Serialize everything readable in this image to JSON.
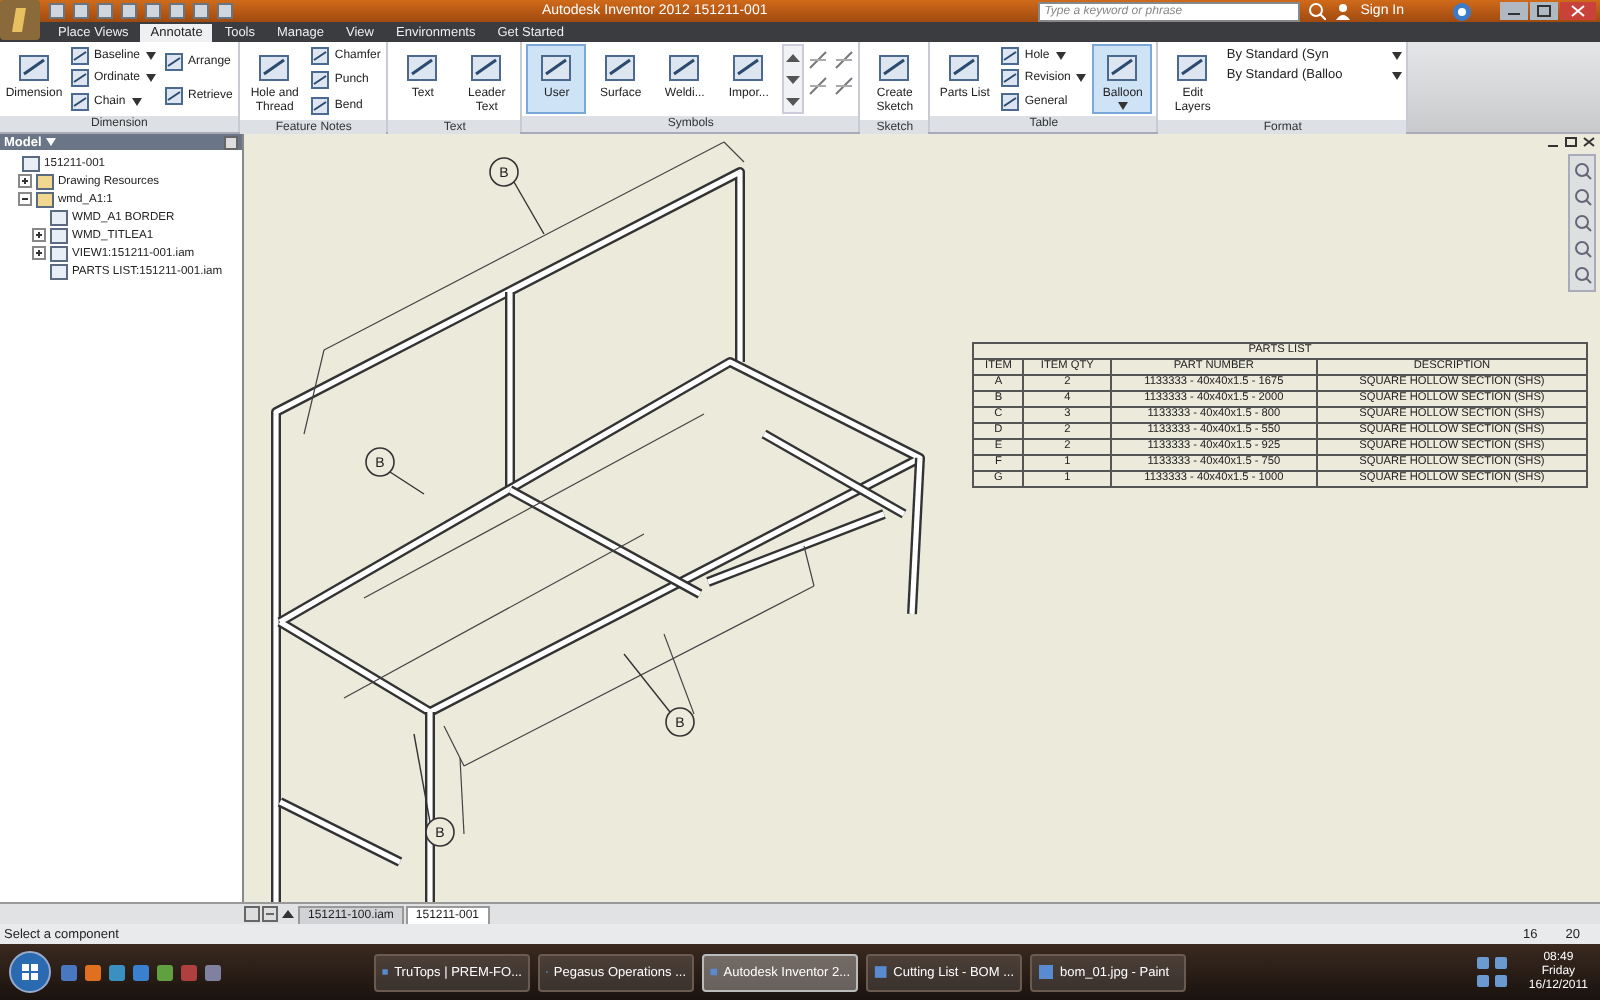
{
  "window": {
    "title": "Autodesk Inventor 2012   151211-001",
    "search": {
      "placeholder": "Type a keyword or phrase"
    },
    "sign_in": "Sign In"
  },
  "ribbon_tabs": [
    {
      "label": "Place Views",
      "selected": false
    },
    {
      "label": "Annotate",
      "selected": true
    },
    {
      "label": "Tools",
      "selected": false
    },
    {
      "label": "Manage",
      "selected": false
    },
    {
      "label": "View",
      "selected": false
    },
    {
      "label": "Environments",
      "selected": false
    },
    {
      "label": "Get Started",
      "selected": false
    }
  ],
  "ribbon": {
    "groups": [
      {
        "label": "Dimension",
        "items": [
          {
            "kind": "large",
            "label": "Dimension",
            "selected": false
          },
          {
            "kind": "small",
            "label": "Baseline",
            "dropdown": true,
            "selected": false
          },
          {
            "kind": "small",
            "label": "Ordinate",
            "dropdown": true,
            "selected": false
          },
          {
            "kind": "small",
            "label": "Chain",
            "dropdown": true,
            "selected": false
          },
          {
            "kind": "small",
            "label": "Arrange",
            "selected": false
          },
          {
            "kind": "small",
            "label": "Retrieve",
            "selected": false
          }
        ]
      },
      {
        "label": "Feature Notes",
        "items": [
          {
            "kind": "large",
            "label": "Hole and Thread",
            "selected": false
          },
          {
            "kind": "small",
            "label": "Chamfer",
            "selected": false
          },
          {
            "kind": "small",
            "label": "Punch",
            "selected": false
          },
          {
            "kind": "small",
            "label": "Bend",
            "selected": false
          }
        ]
      },
      {
        "label": "Text",
        "items": [
          {
            "kind": "large",
            "label": "Text",
            "selected": false
          },
          {
            "kind": "large",
            "label": "Leader Text",
            "selected": false
          }
        ]
      },
      {
        "label": "Symbols",
        "items": [
          {
            "kind": "large",
            "label": "User",
            "selected": true
          },
          {
            "kind": "large",
            "label": "Surface",
            "selected": false
          },
          {
            "kind": "large",
            "label": "Weldi...",
            "selected": false
          },
          {
            "kind": "large",
            "label": "Impor...",
            "selected": false
          },
          {
            "kind": "icons",
            "selected": false
          }
        ]
      },
      {
        "label": "Sketch",
        "items": [
          {
            "kind": "large",
            "label": "Create Sketch",
            "selected": false
          }
        ]
      },
      {
        "label": "Table",
        "items": [
          {
            "kind": "large",
            "label": "Parts List",
            "selected": false
          },
          {
            "kind": "small",
            "label": "Hole",
            "dropdown": true,
            "selected": false
          },
          {
            "kind": "small",
            "label": "Revision",
            "dropdown": true,
            "selected": false
          },
          {
            "kind": "small",
            "label": "General",
            "selected": false
          },
          {
            "kind": "large",
            "label": "Balloon",
            "dropdown": true,
            "selected": true
          }
        ]
      },
      {
        "label": "Format",
        "items": [
          {
            "kind": "large",
            "label": "Edit Layers",
            "selected": false
          },
          {
            "kind": "combo",
            "label": "By Standard (Syn",
            "selected": false
          },
          {
            "kind": "combo",
            "label": "By Standard (Balloo",
            "selected": false
          }
        ]
      }
    ]
  },
  "browser": {
    "title": "Model",
    "tree": [
      {
        "label": "151211-001",
        "children": [
          {
            "label": "Drawing Resources",
            "expanded": false
          },
          {
            "label": "wmd_A1:1",
            "expanded": true,
            "children": [
              {
                "label": "WMD_A1 BORDER"
              },
              {
                "label": "WMD_TITLEA1",
                "expanded": false
              },
              {
                "label": "VIEW1:151211-001.iam",
                "expanded": false
              },
              {
                "label": "PARTS LIST:151211-001.iam"
              }
            ]
          }
        ]
      }
    ]
  },
  "drawing": {
    "balloons": [
      "B",
      "B",
      "B",
      "B"
    ],
    "parts_list": {
      "title": "PARTS LIST",
      "columns": [
        "ITEM",
        "ITEM QTY",
        "PART NUMBER",
        "DESCRIPTION"
      ],
      "rows": [
        [
          "A",
          "2",
          "1133333 - 40x40x1.5 - 1675",
          "SQUARE HOLLOW SECTION (SHS)"
        ],
        [
          "B",
          "4",
          "1133333 - 40x40x1.5 - 2000",
          "SQUARE HOLLOW SECTION (SHS)"
        ],
        [
          "C",
          "3",
          "1133333 - 40x40x1.5 - 800",
          "SQUARE HOLLOW SECTION (SHS)"
        ],
        [
          "D",
          "2",
          "1133333 - 40x40x1.5 - 550",
          "SQUARE HOLLOW SECTION (SHS)"
        ],
        [
          "E",
          "2",
          "1133333 - 40x40x1.5 - 925",
          "SQUARE HOLLOW SECTION (SHS)"
        ],
        [
          "F",
          "1",
          "1133333 - 40x40x1.5 - 750",
          "SQUARE HOLLOW SECTION (SHS)"
        ],
        [
          "G",
          "1",
          "1133333 - 40x40x1.5 - 1000",
          "SQUARE HOLLOW SECTION (SHS)"
        ]
      ]
    }
  },
  "document_tabs": [
    {
      "label": "151211-100.iam",
      "selected": false
    },
    {
      "label": "151211-001",
      "selected": true
    }
  ],
  "status_bar": {
    "message": "Select a component",
    "counts": [
      "16",
      "20"
    ]
  },
  "taskbar": {
    "items": [
      {
        "label": "TruTops | PREM-FO...",
        "selected": false
      },
      {
        "label": "Pegasus Operations ...",
        "selected": false
      },
      {
        "label": "Autodesk Inventor 2...",
        "selected": true
      },
      {
        "label": "Cutting List - BOM ...",
        "selected": false
      },
      {
        "label": "bom_01.jpg - Paint",
        "selected": false
      }
    ],
    "time": "08:49",
    "day": "Friday",
    "date": "16/12/2011"
  }
}
